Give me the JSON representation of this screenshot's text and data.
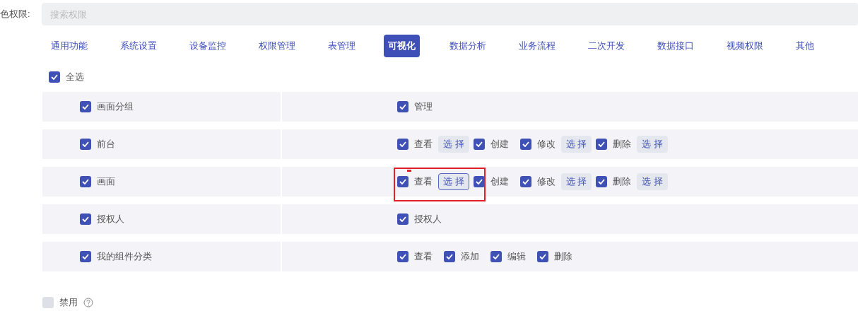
{
  "role_label": "色权限:",
  "search": {
    "placeholder": "搜索权限"
  },
  "tabs": [
    {
      "label": "通用功能",
      "selected": false
    },
    {
      "label": "系统设置",
      "selected": false
    },
    {
      "label": "设备监控",
      "selected": false
    },
    {
      "label": "权限管理",
      "selected": false
    },
    {
      "label": "表管理",
      "selected": false
    },
    {
      "label": "可视化",
      "selected": true
    },
    {
      "label": "数据分析",
      "selected": false
    },
    {
      "label": "业务流程",
      "selected": false
    },
    {
      "label": "二次开发",
      "selected": false
    },
    {
      "label": "数据接口",
      "selected": false
    },
    {
      "label": "视频权限",
      "selected": false
    },
    {
      "label": "其他",
      "selected": false
    }
  ],
  "select_all": {
    "label": "全选",
    "checked": true
  },
  "rows": [
    {
      "label": "画面分组",
      "checked": true,
      "highlighted": false,
      "actions": [
        {
          "kind": "checkbox",
          "label": "管理",
          "checked": true
        }
      ]
    },
    {
      "label": "前台",
      "checked": true,
      "highlighted": false,
      "actions": [
        {
          "kind": "checkbox",
          "label": "查看",
          "checked": true
        },
        {
          "kind": "select",
          "label": "选 择",
          "focused": false
        },
        {
          "kind": "checkbox",
          "label": "创建",
          "checked": true
        },
        {
          "kind": "checkbox",
          "label": "修改",
          "checked": true
        },
        {
          "kind": "select",
          "label": "选 择",
          "focused": false
        },
        {
          "kind": "checkbox",
          "label": "删除",
          "checked": true
        },
        {
          "kind": "select",
          "label": "选 择",
          "focused": false
        }
      ]
    },
    {
      "label": "画面",
      "checked": true,
      "highlighted": true,
      "actions": [
        {
          "kind": "checkbox",
          "label": "查看",
          "checked": true
        },
        {
          "kind": "select",
          "label": "选 择",
          "focused": true
        },
        {
          "kind": "checkbox",
          "label": "创建",
          "checked": true
        },
        {
          "kind": "checkbox",
          "label": "修改",
          "checked": true
        },
        {
          "kind": "select",
          "label": "选 择",
          "focused": false
        },
        {
          "kind": "checkbox",
          "label": "删除",
          "checked": true
        },
        {
          "kind": "select",
          "label": "选 择",
          "focused": false
        }
      ]
    },
    {
      "label": "授权人",
      "checked": true,
      "highlighted": false,
      "actions": [
        {
          "kind": "checkbox",
          "label": "授权人",
          "checked": true
        }
      ]
    },
    {
      "label": "我的组件分类",
      "checked": true,
      "highlighted": false,
      "actions": [
        {
          "kind": "checkbox",
          "label": "查看",
          "checked": true
        },
        {
          "kind": "checkbox",
          "label": "添加",
          "checked": true
        },
        {
          "kind": "checkbox",
          "label": "编辑",
          "checked": true
        },
        {
          "kind": "checkbox",
          "label": "删除",
          "checked": true
        }
      ]
    }
  ],
  "disable": {
    "label": "禁用",
    "checked": false
  }
}
